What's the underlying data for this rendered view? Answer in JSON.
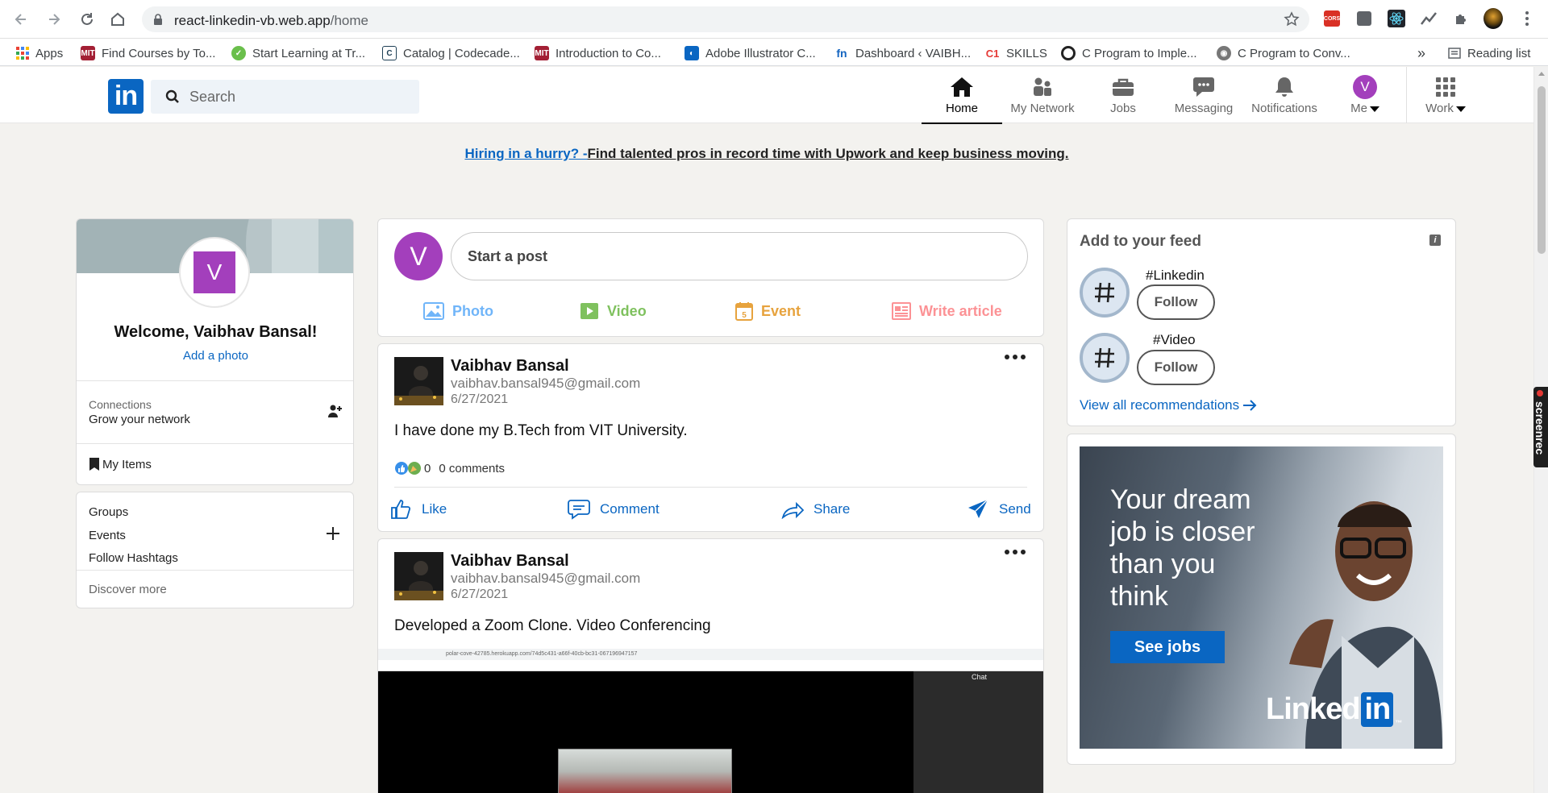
{
  "browser": {
    "url_host": "react-linkedin-vb.web.app",
    "url_path": "/home",
    "reading_list": "Reading list",
    "more_bookmarks": "»",
    "bookmarks": [
      {
        "label": "Apps",
        "icon": "apps-grid-icon",
        "color": "#ea4335"
      },
      {
        "label": "Find Courses by To...",
        "icon": "mit-ocw-icon",
        "color": "#a31f34"
      },
      {
        "label": "Start Learning at Tr...",
        "icon": "leaf-icon",
        "color": "#6abf4b"
      },
      {
        "label": "Catalog | Codecade...",
        "icon": "codecademy-icon",
        "color": "#1f4056"
      },
      {
        "label": "Introduction to Co...",
        "icon": "mit-ocw-icon",
        "color": "#a31f34"
      },
      {
        "label": "Adobe Illustrator C...",
        "icon": "adobe-icon",
        "color": "#0a66c2"
      },
      {
        "label": "Dashboard ‹ VAIBH...",
        "icon": "fn-icon",
        "color": "#1565c0"
      },
      {
        "label": "SKILLS",
        "icon": "c1-icon",
        "color": "#e53935"
      },
      {
        "label": "C Program to Imple...",
        "icon": "circle-icon",
        "color": "#222222"
      },
      {
        "label": "C Program to Conv...",
        "icon": "globe-icon",
        "color": "#555555"
      }
    ]
  },
  "header": {
    "logo": "in",
    "search_placeholder": "Search",
    "nav": [
      {
        "label": "Home",
        "icon": "home-icon",
        "active": true
      },
      {
        "label": "My Network",
        "icon": "network-icon",
        "active": false
      },
      {
        "label": "Jobs",
        "icon": "briefcase-icon",
        "active": false
      },
      {
        "label": "Messaging",
        "icon": "chat-bubble-icon",
        "active": false
      },
      {
        "label": "Notifications",
        "icon": "bell-icon",
        "active": false
      },
      {
        "label": "Me",
        "icon": "avatar",
        "avatar_letter": "V",
        "active": false
      },
      {
        "label": "Work",
        "icon": "grid-icon",
        "active": false
      }
    ]
  },
  "banner": {
    "link": "Hiring in a hurry? -",
    "text": "Find talented pros in record time with Upwork and keep business moving."
  },
  "sidebar": {
    "avatar_letter": "V",
    "welcome": "Welcome, Vaibhav Bansal!",
    "add_photo": "Add a photo",
    "connections_label": "Connections",
    "connections_sub": "Grow your network",
    "my_items": "My Items",
    "groups": "Groups",
    "events": "Events",
    "follow_hashtags": "Follow Hashtags",
    "discover_more": "Discover more"
  },
  "share": {
    "avatar_letter": "V",
    "placeholder": "Start a post",
    "actions": [
      {
        "label": "Photo",
        "icon": "photo-icon",
        "color": "#70b5f9"
      },
      {
        "label": "Video",
        "icon": "video-icon",
        "color": "#7fc15e"
      },
      {
        "label": "Event",
        "icon": "calendar-icon",
        "color": "#e7a33e"
      },
      {
        "label": "Write article",
        "icon": "article-icon",
        "color": "#fc9295"
      }
    ]
  },
  "posts": [
    {
      "name": "Vaibhav Bansal",
      "email": "vaibhav.bansal945@gmail.com",
      "date": "6/27/2021",
      "text": "I have done my B.Tech from VIT University.",
      "reactions": "0",
      "comments": "0 comments",
      "actions": [
        {
          "label": "Like",
          "icon": "thumbs-up-icon"
        },
        {
          "label": "Comment",
          "icon": "comment-icon"
        },
        {
          "label": "Share",
          "icon": "share-icon"
        },
        {
          "label": "Send",
          "icon": "send-icon"
        }
      ]
    },
    {
      "name": "Vaibhav Bansal",
      "email": "vaibhav.bansal945@gmail.com",
      "date": "6/27/2021",
      "text": "Developed a Zoom Clone. Video Conferencing",
      "image_url_text": "polar-cove-42785.herokuapp.com/74d5c431-a66f-40cb-bc31-06719694715​7",
      "image_chat": "Chat"
    }
  ],
  "feed": {
    "title": "Add to your feed",
    "hashtags": [
      {
        "name": "#Linkedin",
        "follow": "Follow"
      },
      {
        "name": "#Video",
        "follow": "Follow"
      }
    ],
    "view_all": "View all recommendations"
  },
  "ad": {
    "text": "Your dream job is closer than you think",
    "cta": "See jobs",
    "logo_linked": "Linked",
    "logo_in": "in",
    "logo_tm": "™"
  },
  "screenrec": "screenrec",
  "colors": {
    "linkedin_blue": "#0a66c2",
    "avatar_purple": "#a33fbc",
    "page_bg": "#f3f2ef"
  }
}
